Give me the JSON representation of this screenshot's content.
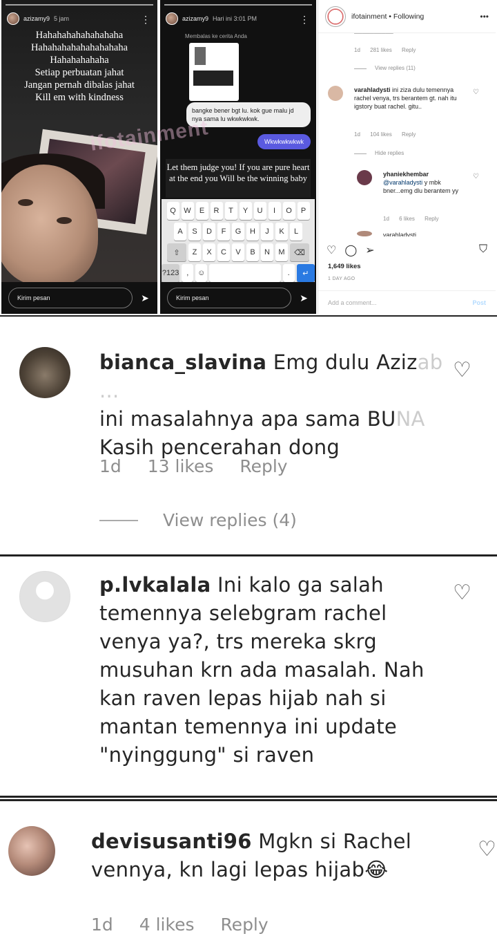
{
  "story1": {
    "username": "azizamy9",
    "time": "5 jam",
    "text_lines": [
      "Hahahahahahahahaha",
      "Hahahahahahahahahaha",
      "Hahahahahaha",
      "Setiap perbuatan jahat",
      "Jangan pernah dibalas jahat",
      "Kill em with kindness"
    ],
    "send_placeholder": "Kirim pesan"
  },
  "story2": {
    "username": "azizamy9",
    "time": "Hari ini 3:01 PM",
    "reply_label": "Membalas ke cerita Anda",
    "bubble_text": "bangke bener bgt lu. kok gue malu jd nya sama lu wkwkwkwk.",
    "my_message": "Wkwkwkwkwk",
    "quote_text": "Let them judge you! If you are pure heart at the end you Will be the winning baby",
    "keyboard_rows": [
      [
        "Q",
        "W",
        "E",
        "R",
        "T",
        "Y",
        "U",
        "I",
        "O",
        "P"
      ],
      [
        "A",
        "S",
        "D",
        "F",
        "G",
        "H",
        "J",
        "K",
        "L"
      ],
      [
        "Z",
        "X",
        "C",
        "V",
        "B",
        "N",
        "M"
      ]
    ],
    "key_symbols": "?123",
    "send_placeholder": "Kirim pesan"
  },
  "instagram": {
    "username": "ifotainment",
    "following": "Following",
    "comments": [
      {
        "meta": [
          "1d",
          "281 likes",
          "Reply"
        ],
        "view_replies": "View replies (11)"
      },
      {
        "user": "varahladysti",
        "text": "ini ziza dulu temennya rachel venya, trs berantem gt. nah itu igstory buat rachel. gitu..",
        "meta": [
          "1d",
          "104 likes",
          "Reply"
        ],
        "view_replies": "Hide replies"
      },
      {
        "user": "yhaniekhembar",
        "mention": "@varahladysti",
        "text": "y mbk bner...emg dlu berantem yy",
        "meta": [
          "1d",
          "6 likes",
          "Reply"
        ]
      },
      {
        "user": "varahladysti"
      }
    ],
    "likes": "1,649 likes",
    "time_ago": "1 DAY AGO",
    "add_comment": "Add a comment...",
    "post_label": "Post",
    "watermark": "ifotainment"
  },
  "zoom_comments": [
    {
      "user": "bianca_slavina",
      "lines": [
        "Emg dulu Aziz",
        "ini masalahnya apa sama BU",
        "Kasih pencerahan dong"
      ],
      "meta": [
        "1d",
        "13 likes",
        "Reply"
      ],
      "view_replies": "View replies (4)"
    },
    {
      "user": "p.lvkalala",
      "lines": [
        "Ini kalo ga salah",
        "temennya selebgram rachel",
        "venya ya?, trs mereka skrg",
        "musuhan krn ada masalah. Nah",
        "kan raven lepas hijab nah si",
        "mantan temennya ini update",
        "\"nyinggung\" si raven"
      ]
    },
    {
      "user": "devisusanti96",
      "lines": [
        "Mgkn si Rachel",
        "vennya, kn lagi lepas hijab😂"
      ],
      "meta": [
        "1d",
        "4 likes",
        "Reply"
      ]
    }
  ]
}
